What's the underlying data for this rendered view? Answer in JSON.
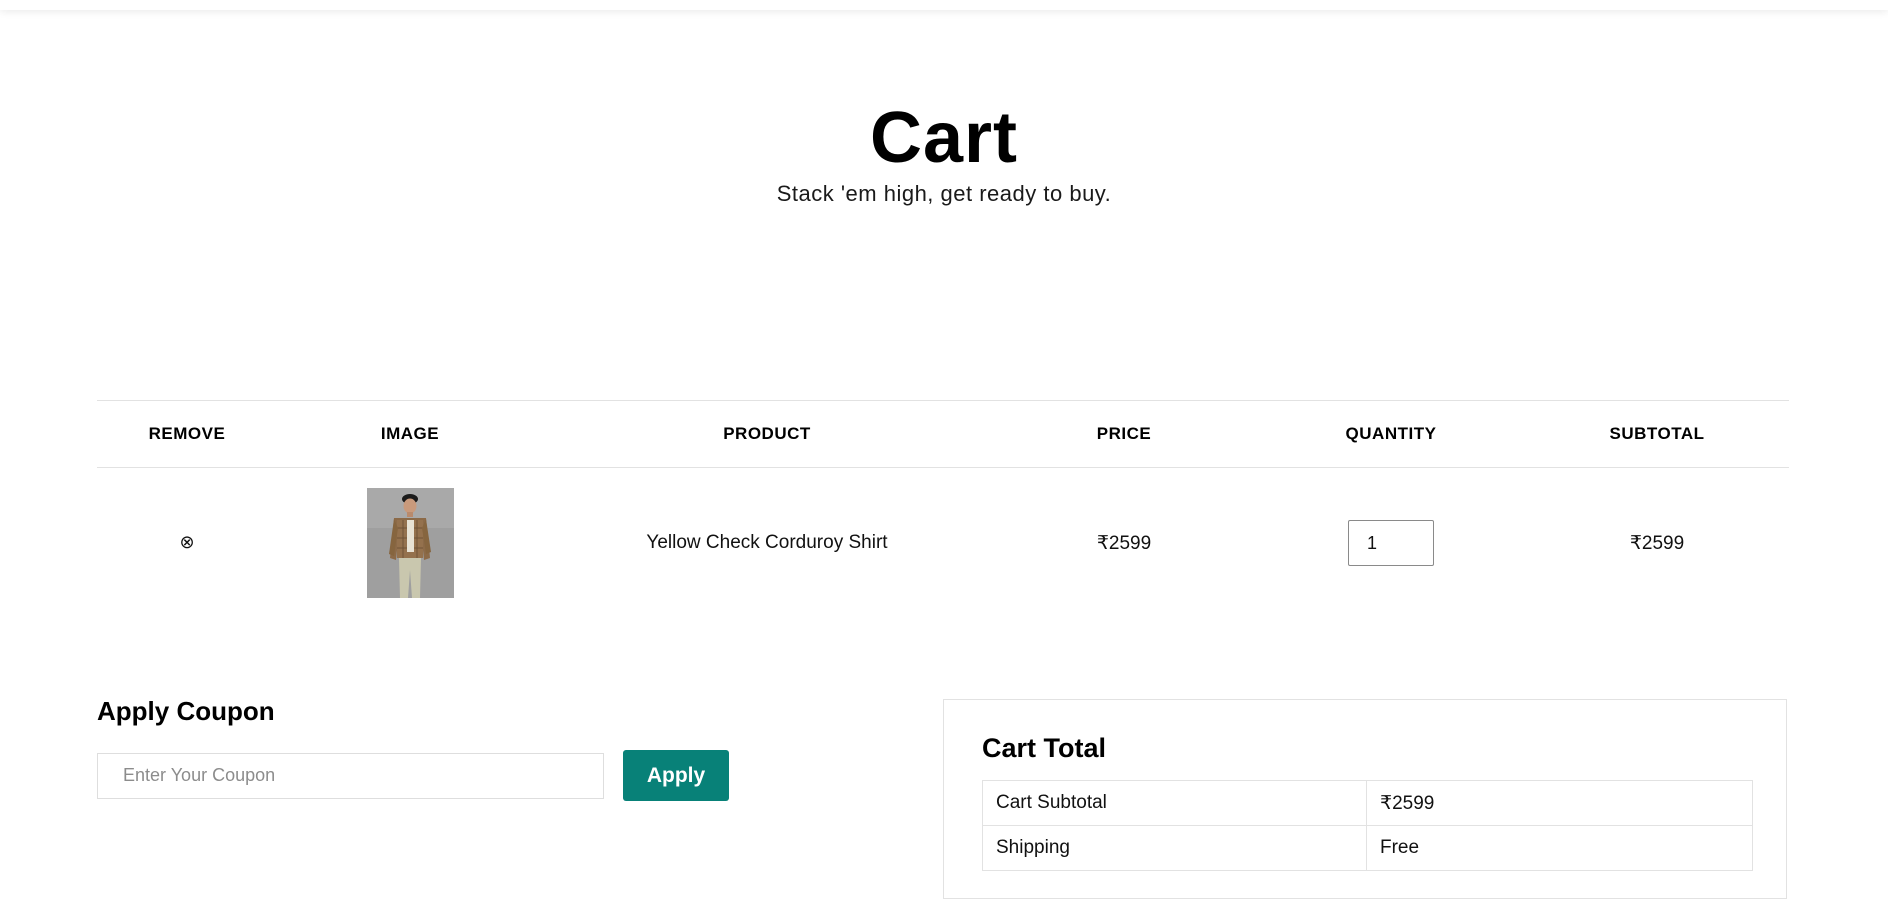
{
  "hero": {
    "title": "Cart",
    "subtitle": "Stack 'em high, get ready to buy."
  },
  "cart_table": {
    "headers": [
      "REMOVE",
      "IMAGE",
      "PRODUCT",
      "PRICE",
      "QUANTITY",
      "SUBTOTAL"
    ],
    "rows": [
      {
        "remove_icon": "⊗",
        "product": "Yellow Check Corduroy Shirt",
        "price": "₹2599",
        "quantity": "1",
        "subtotal": "₹2599"
      }
    ]
  },
  "coupon": {
    "title": "Apply Coupon",
    "placeholder": "Enter Your Coupon",
    "button_label": "Apply"
  },
  "cart_total": {
    "title": "Cart Total",
    "rows": [
      {
        "label": "Cart Subtotal",
        "value": "₹2599"
      },
      {
        "label": "Shipping",
        "value": "Free"
      }
    ]
  },
  "colors": {
    "accent": "#088178",
    "border": "#e2e2e2"
  }
}
